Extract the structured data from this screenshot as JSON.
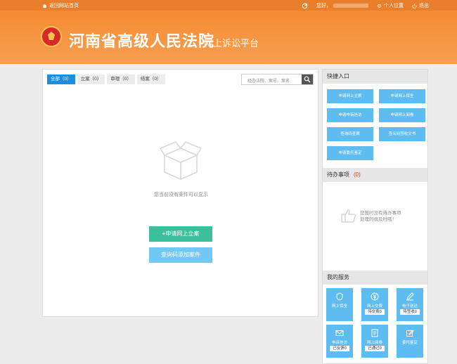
{
  "topbar": {
    "home_label": "返回网站首页",
    "greeting": "您好，",
    "settings_label": "个人设置",
    "logout_label": "退出"
  },
  "header": {
    "court_name": "河南省高级人民法院",
    "platform_name": "网上诉讼平台"
  },
  "tabs": [
    {
      "label": "全部（0）"
    },
    {
      "label": "立案（0）"
    },
    {
      "label": "审理（0）"
    },
    {
      "label": "结案（0）"
    }
  ],
  "search": {
    "placeholder": "经办法院、案号、案名"
  },
  "empty": {
    "message": "您当前没有案件可以显示",
    "apply_button": "+申请网上立案",
    "query_button": "查询码添加案件"
  },
  "quick_entry": {
    "title": "快捷入口",
    "buttons": [
      {
        "label": "申请网上立案"
      },
      {
        "label": "申请网上保全"
      },
      {
        "label": "申请申诉信访"
      },
      {
        "label": "申请网上阅卷"
      },
      {
        "label": "查询码查案"
      },
      {
        "label": "签名码签收文书"
      },
      {
        "label": "申请委托鉴定"
      }
    ]
  },
  "todo": {
    "title": "待办事项",
    "count": "(0)",
    "empty_line1": "您暂时没有待办事项",
    "empty_line2": "处理的很及时哦！"
  },
  "services": {
    "title": "我的服务",
    "items": [
      {
        "label": "网上保全",
        "count": "",
        "icon": "shield-icon"
      },
      {
        "label": "网上交费",
        "count": "待交费0",
        "icon": "yuan-icon"
      },
      {
        "label": "电子送达",
        "count": "待签收0",
        "icon": "pen-icon"
      },
      {
        "label": "申诉信访",
        "count": "已反馈0",
        "icon": "mail-icon"
      },
      {
        "label": "网上阅卷",
        "count": "已通过0",
        "icon": "document-icon"
      },
      {
        "label": "委托鉴定",
        "count": "",
        "icon": "edit-icon"
      }
    ]
  },
  "colors": {
    "brand_orange": "#f58a31",
    "primary_blue": "#1e8de0",
    "tile_blue": "#5fbcf0",
    "apply_green": "#3cbf9a"
  }
}
